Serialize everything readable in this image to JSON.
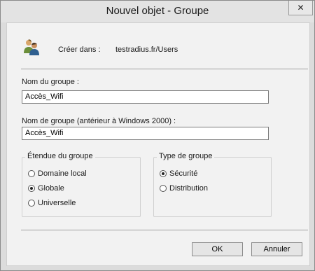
{
  "window": {
    "title": "Nouvel objet - Groupe",
    "close_glyph": "✕"
  },
  "create_in": {
    "label": "Créer dans :",
    "value": "testradius.fr/Users"
  },
  "group_name": {
    "label": "Nom du groupe :",
    "value": "Accès_Wifi"
  },
  "group_name_pre2000": {
    "label": "Nom de groupe (antérieur à Windows 2000) :",
    "value": "Accès_Wifi"
  },
  "scope": {
    "title": "Étendue du groupe",
    "options": [
      {
        "label": "Domaine local",
        "selected": false
      },
      {
        "label": "Globale",
        "selected": true
      },
      {
        "label": "Universelle",
        "selected": false
      }
    ]
  },
  "type": {
    "title": "Type de groupe",
    "options": [
      {
        "label": "Sécurité",
        "selected": true
      },
      {
        "label": "Distribution",
        "selected": false
      }
    ]
  },
  "buttons": {
    "ok": "OK",
    "cancel": "Annuler"
  }
}
